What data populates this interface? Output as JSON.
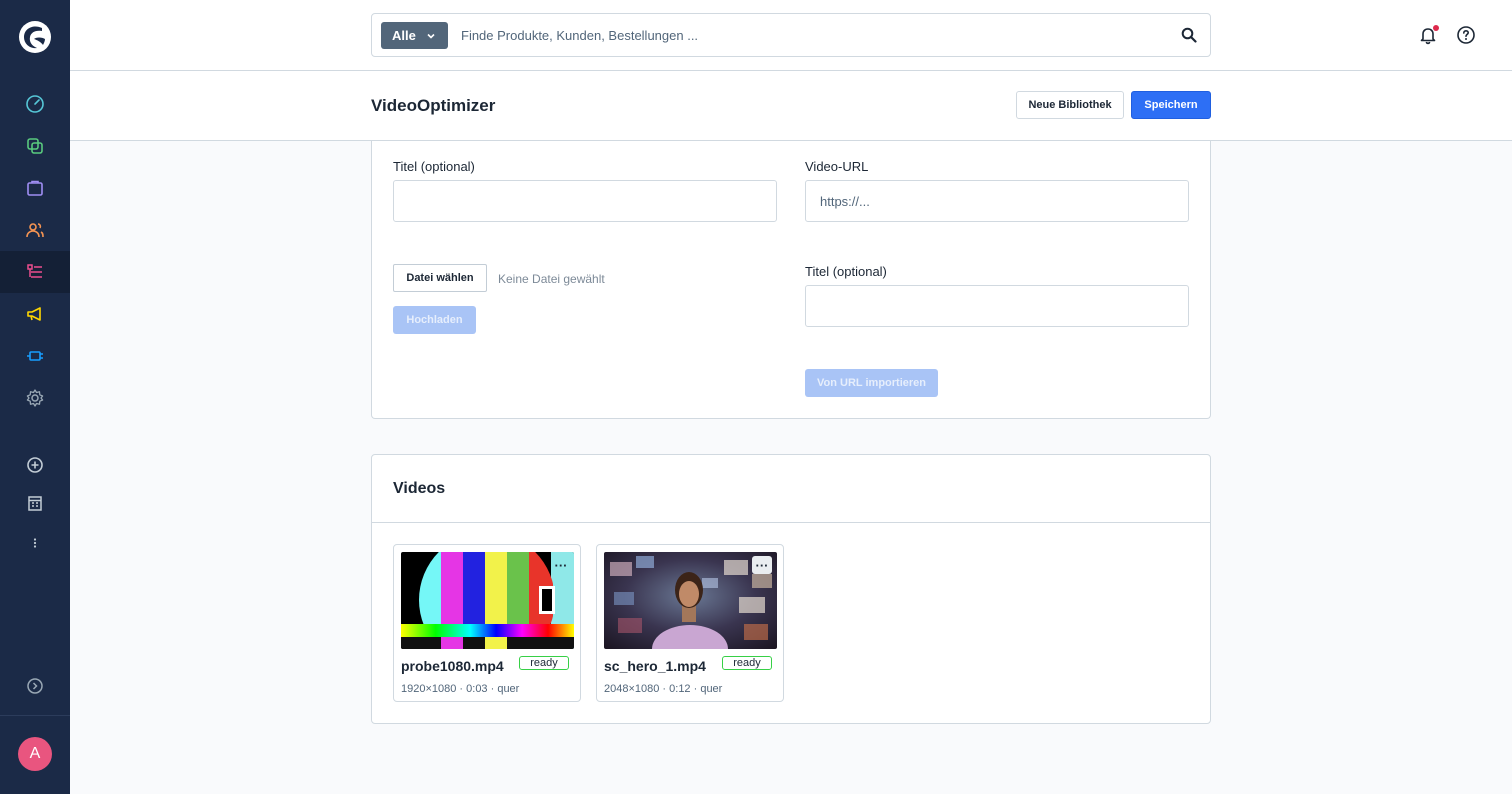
{
  "sidebar": {
    "nav_items": [
      {
        "name": "dashboard"
      },
      {
        "name": "catalogues"
      },
      {
        "name": "orders"
      },
      {
        "name": "customers"
      },
      {
        "name": "content",
        "active": true
      },
      {
        "name": "marketing"
      },
      {
        "name": "extensions"
      },
      {
        "name": "settings"
      },
      {
        "name": "add-sales-channel"
      },
      {
        "name": "sales-channel-storefront"
      },
      {
        "name": "more"
      },
      {
        "name": "help"
      }
    ],
    "avatar_initial": "A",
    "colors": {
      "background": "#1b2a47",
      "active": "#142036"
    }
  },
  "header": {
    "search": {
      "type_label": "Alle",
      "placeholder": "Finde Produkte, Kunden, Bestellungen ..."
    }
  },
  "smartbar": {
    "title": "VideoOptimizer",
    "new_library_label": "Neue Bibliothek",
    "save_label": "Speichern"
  },
  "upload": {
    "left": {
      "title_label": "Titel (optional)",
      "title_value": "",
      "file_button_label": "Datei wählen",
      "no_file_text": "Keine Datei gewählt",
      "upload_label": "Hochladen"
    },
    "right": {
      "url_label": "Video-URL",
      "url_placeholder": "https://...",
      "title_label": "Titel (optional)",
      "title_value": "",
      "import_label": "Von URL importieren"
    }
  },
  "videos": {
    "title": "Videos",
    "items": [
      {
        "name": "probe1080.mp4",
        "status": "ready",
        "meta": "1920×1080 · 0:03 · quer",
        "more": "···"
      },
      {
        "name": "sc_hero_1.mp4",
        "status": "ready",
        "meta": "2048×1080 · 0:12 · quer",
        "more": "···"
      }
    ]
  },
  "colors": {
    "primary": "#2d6ff5",
    "ready_border": "#37d046",
    "notification": "#de294c"
  }
}
